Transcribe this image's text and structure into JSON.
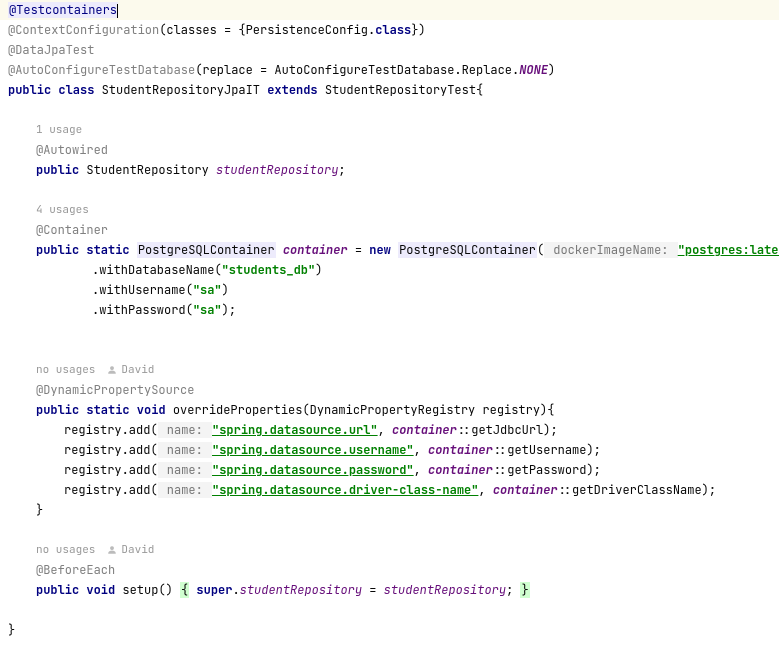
{
  "l1": {
    "anno": "@Testcontainers"
  },
  "l2": {
    "anno": "@ContextConfiguration",
    "after": "(classes = {PersistenceConfig.",
    "kw": "class",
    "close": "})"
  },
  "l3": {
    "anno": "@DataJpaTest"
  },
  "l4": {
    "anno": "@AutoConfigureTestDatabase",
    "after": "(replace = ",
    "type": "AutoConfigureTestDatabase.Replace",
    "dot": ".",
    "const": "NONE",
    "close": ")"
  },
  "l5": {
    "kw1": "public class ",
    "cls": "StudentRepositoryJpaIT ",
    "kw2": "extends ",
    "sup": "StudentRepositoryTest{"
  },
  "usage1": "1 usage",
  "l7": {
    "anno": "@Autowired"
  },
  "l8": {
    "kw": "public ",
    "type": "StudentRepository ",
    "fld": "studentRepository",
    "semi": ";"
  },
  "usage2": "4 usages",
  "l10": {
    "anno": "@Container"
  },
  "l11": {
    "kw": "public static ",
    "t1": "PostgreSQLContainer",
    "sp1": " ",
    "fld": "container",
    "eq": " = ",
    "kwnew": "new ",
    "t2": "PostgreSQLContainer",
    "open": "(",
    "hint": " dockerImageName: ",
    "str": "\"postgres:latest\"",
    "close": ")"
  },
  "l12": {
    "pre": ".withDatabaseName(",
    "str": "\"students_db\"",
    "close": ")"
  },
  "l13": {
    "pre": ".withUsername(",
    "str": "\"sa\"",
    "close": ")"
  },
  "l14": {
    "pre": ".withPassword(",
    "str": "\"sa\"",
    "close": ");"
  },
  "usage3": {
    "u": "no usages",
    "a": "David"
  },
  "l16": {
    "anno": "@DynamicPropertySource"
  },
  "l17": {
    "kw": "public static void ",
    "m": "overrideProperties",
    "sig": "(DynamicPropertyRegistry registry){"
  },
  "l18": {
    "pre": "registry.add(",
    "hint": " name: ",
    "str": "\"spring.datasource.url\"",
    "mid": ", ",
    "fld": "container",
    "suf": "::getJdbcUrl);"
  },
  "l19": {
    "pre": "registry.add(",
    "hint": " name: ",
    "str": "\"spring.datasource.username\"",
    "mid": ", ",
    "fld": "container",
    "suf": "::getUsername);"
  },
  "l20": {
    "pre": "registry.add(",
    "hint": " name: ",
    "str": "\"spring.datasource.password\"",
    "mid": ", ",
    "fld": "container",
    "suf": "::getPassword);"
  },
  "l21": {
    "pre": "registry.add(",
    "hint": " name: ",
    "str": "\"spring.datasource.driver-class-name\"",
    "mid": ", ",
    "fld": "container",
    "suf": "::getDriverClassName);"
  },
  "l22": "}",
  "usage4": {
    "u": "no usages",
    "a": "David"
  },
  "l24": {
    "anno": "@BeforeEach"
  },
  "l25": {
    "kw": "public void ",
    "m": "setup() ",
    "b1": "{",
    "mid": " ",
    "kw2": "super",
    "dot": ".",
    "fld": "studentRepository",
    "eq": " = ",
    "fld2": "studentRepository",
    "semi": "; ",
    "b2": "}"
  },
  "l26": "}"
}
